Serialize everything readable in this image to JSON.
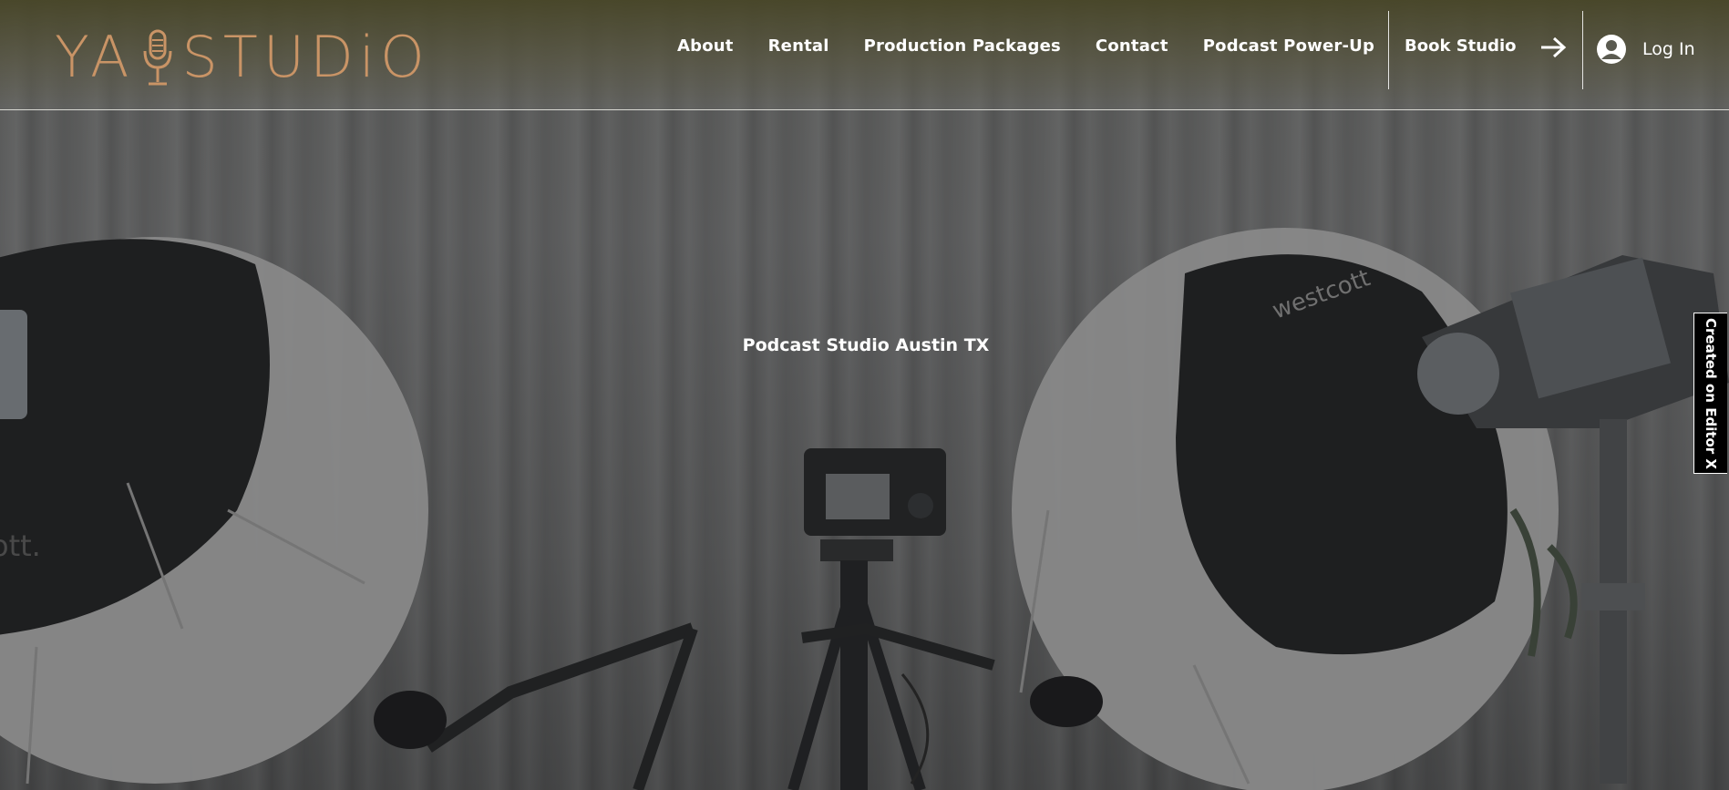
{
  "brand": {
    "logo_text_left": "YA",
    "logo_text_right": "STUDiO",
    "color": "#c99466"
  },
  "nav": {
    "items": [
      {
        "label": "About"
      },
      {
        "label": "Rental"
      },
      {
        "label": "Production Packages"
      },
      {
        "label": "Contact"
      },
      {
        "label": "Podcast Power-Up"
      }
    ],
    "book_label": "Book Studio",
    "book_icon": "arrow-right-icon",
    "login_label": "Log In",
    "login_icon": "user-avatar-icon"
  },
  "hero": {
    "title": "Podcast Studio Austin TX"
  },
  "badge": {
    "label": "Created on Editor X"
  }
}
